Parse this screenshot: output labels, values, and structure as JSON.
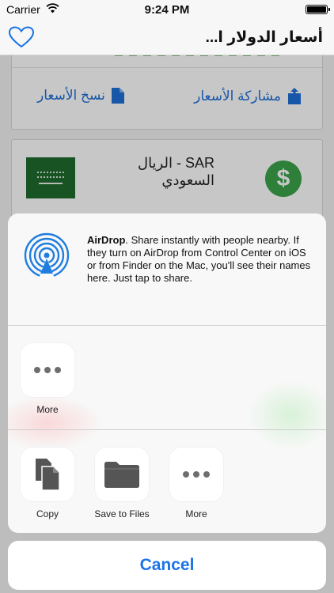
{
  "status_bar": {
    "carrier": "Carrier",
    "time": "9:24 PM"
  },
  "nav": {
    "title": "أسعار الدولار ا...",
    "favorite_icon": "heart-icon"
  },
  "background": {
    "share_prices_label": "مشاركة الأسعار",
    "copy_prices_label": "نسخ الأسعار",
    "currency": {
      "code_name": "SAR - الريال السعودي",
      "dollar_symbol": "$"
    }
  },
  "share_sheet": {
    "airdrop": {
      "title": "AirDrop",
      "description": ". Share instantly with people nearby. If they turn on AirDrop from Control Center on iOS or from Finder on the Mac, you'll see their names here. Just tap to share."
    },
    "apps_row": [
      {
        "label": "More",
        "icon": "more-icon"
      }
    ],
    "actions_row": [
      {
        "label": "Copy",
        "icon": "copy-icon"
      },
      {
        "label": "Save to Files",
        "icon": "folder-icon"
      },
      {
        "label": "More",
        "icon": "more-icon"
      }
    ]
  },
  "cancel_label": "Cancel",
  "colors": {
    "accent": "#1a73e8",
    "green": "#3aa34a",
    "flag_green": "#1e6b2e"
  }
}
